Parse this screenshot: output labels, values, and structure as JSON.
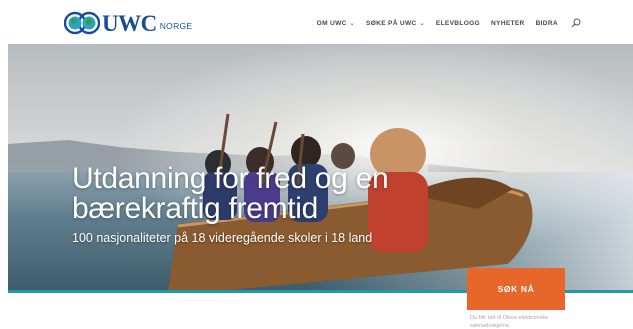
{
  "brand": {
    "name": "UWC",
    "sub": "NORGE"
  },
  "nav": {
    "items": [
      {
        "label": "OM UWC",
        "has_dropdown": true
      },
      {
        "label": "SØKE PÅ UWC",
        "has_dropdown": true
      },
      {
        "label": "ELEVBLOGG",
        "has_dropdown": false
      },
      {
        "label": "NYHETER",
        "has_dropdown": false
      },
      {
        "label": "BIDRA",
        "has_dropdown": false
      }
    ],
    "dropdown_glyph": "⌄",
    "search_icon": "search-icon"
  },
  "hero": {
    "title": "Utdanning for fred og en bærekraftig fremtid",
    "subtitle": "100 nasjonaliteter på 18 videregående skoler i 18 land"
  },
  "cta": {
    "label": "SØK NÅ",
    "note": "Du blir tatt til Oikos elektroniske søknadsskjema"
  },
  "colors": {
    "brand_blue": "#1a4c96",
    "accent_orange": "#e8662a",
    "teal": "#1f9aa6",
    "nav_text": "#4a4a4a"
  }
}
